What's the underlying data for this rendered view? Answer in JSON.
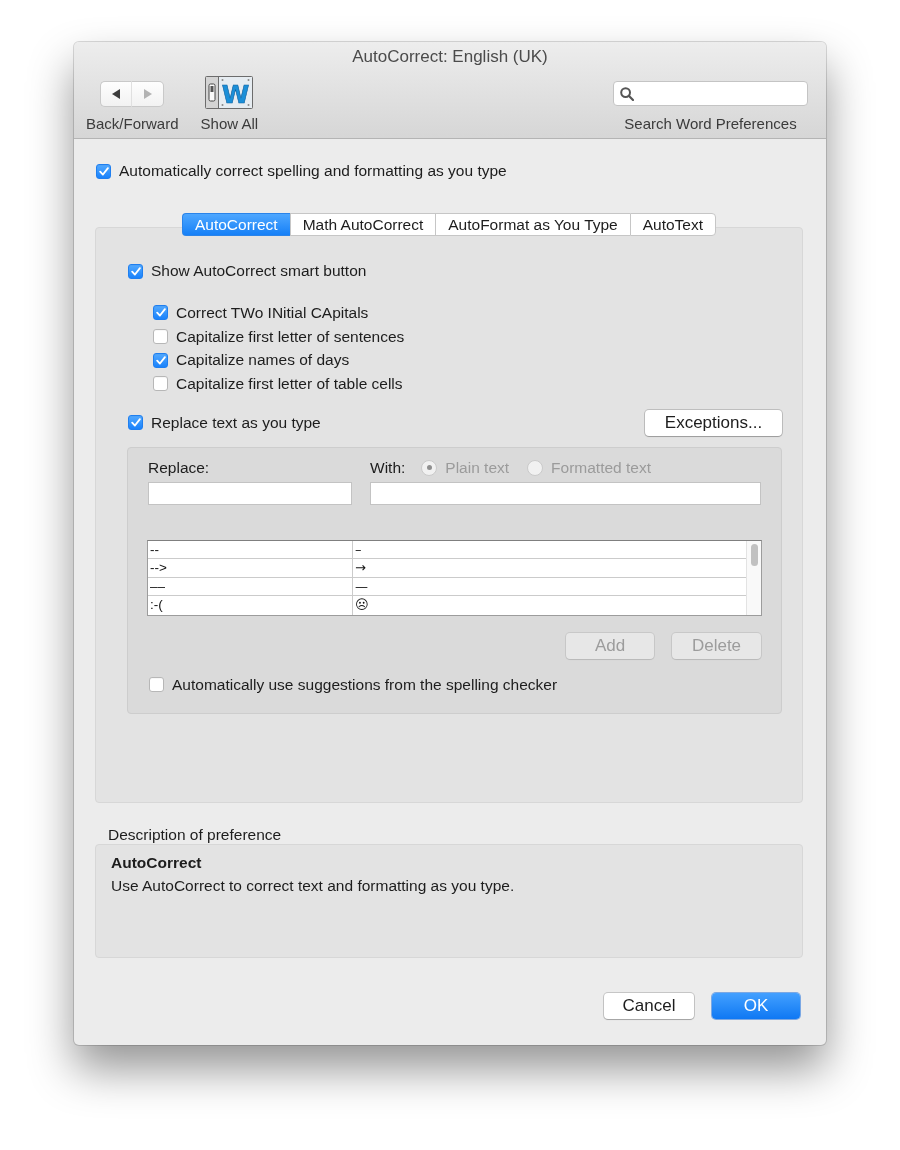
{
  "window": {
    "title": "AutoCorrect: English (UK)"
  },
  "toolbar": {
    "navigation": {
      "label": "Back/Forward",
      "buttons": [
        {
          "kind": "back",
          "disabled": false
        },
        {
          "kind": "forward",
          "disabled": true
        }
      ]
    },
    "show_all": {
      "label": "Show All",
      "icon_letter": "W"
    },
    "search": {
      "label": "Search Word Preferences"
    }
  },
  "autocorrect_enabled": {
    "label": "Automatically correct spelling and formatting as you type",
    "checked": true
  },
  "tabs": [
    {
      "label": "AutoCorrect",
      "selected": true
    },
    {
      "label": "Math AutoCorrect",
      "selected": false
    },
    {
      "label": "AutoFormat as You Type",
      "selected": false
    },
    {
      "label": "AutoText",
      "selected": false
    }
  ],
  "autocorrect": {
    "smart_button": {
      "label": "Show AutoCorrect smart button",
      "checked": true
    },
    "capitalization": [
      {
        "label": "Correct TWo INitial CApitals",
        "checked": true
      },
      {
        "label": "Capitalize first letter of sentences",
        "checked": false
      },
      {
        "label": "Capitalize names of days",
        "checked": true
      },
      {
        "label": "Capitalize first letter of table cells",
        "checked": false
      }
    ],
    "replace_text": {
      "label": "Replace text as you type",
      "checked": true
    },
    "exceptions_button": {
      "label": "Exceptions..."
    },
    "replace_panel": {
      "replace_label": "Replace:",
      "with_label": "With:",
      "format_disabled": true,
      "format_options": [
        {
          "label": "Plain text",
          "selected": true
        },
        {
          "label": "Formatted text",
          "selected": false
        }
      ],
      "entries": [
        {
          "replace": "--",
          "with": "–"
        },
        {
          "replace": "-->",
          "with": "→"
        },
        {
          "replace": "––",
          "with": "—"
        },
        {
          "replace": ":-(",
          "with": "☹"
        }
      ],
      "buttons": [
        {
          "label": "Add",
          "disabled": true
        },
        {
          "label": "Delete",
          "disabled": true
        }
      ],
      "use_suggestions": {
        "label": "Automatically use suggestions from the spelling checker",
        "checked": false
      }
    }
  },
  "description": {
    "heading": "Description of preference",
    "title": "AutoCorrect",
    "text": "Use AutoCorrect to correct text and formatting as you type."
  },
  "buttons": [
    {
      "label": "Cancel",
      "kind": "secondary"
    },
    {
      "label": "OK",
      "kind": "primary"
    }
  ]
}
